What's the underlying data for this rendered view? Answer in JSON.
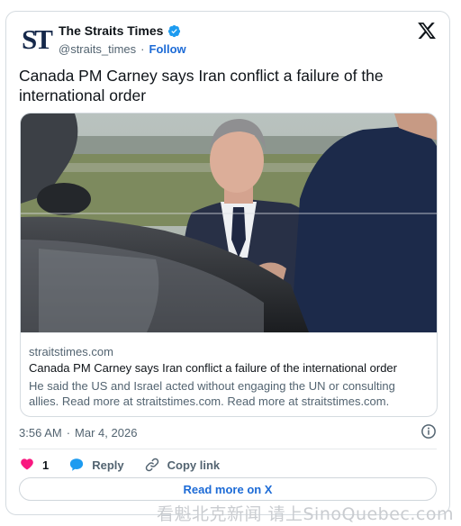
{
  "author": {
    "logo_text": "ST",
    "name": "The Straits Times",
    "handle": "@straits_times",
    "separator": "·",
    "follow_label": "Follow"
  },
  "tweet": {
    "text": "Canada PM Carney says Iran conflict a failure of the international order"
  },
  "link_card": {
    "domain": "straitstimes.com",
    "title": "Canada PM Carney says Iran conflict a failure of the international order",
    "description": "He said the US and Israel acted without engaging the UN or consulting allies. Read more at straitstimes.com. Read more at straitstimes.com."
  },
  "meta": {
    "time": "3:56 AM",
    "separator": "·",
    "date": "Mar 4, 2026"
  },
  "actions": {
    "like_count": "1",
    "reply_label": "Reply",
    "copy_link_label": "Copy link"
  },
  "read_more_label": "Read more on X",
  "watermark": "看魁北克新闻 请上SinoQuebec.com",
  "colors": {
    "accent": "#1d6bd6",
    "heart": "#f91880",
    "verified": "#1d9bf0",
    "logo": "#15284a"
  },
  "icons": [
    "verified-badge-icon",
    "x-logo-icon",
    "info-icon",
    "heart-icon",
    "reply-bubble-icon",
    "link-icon"
  ]
}
